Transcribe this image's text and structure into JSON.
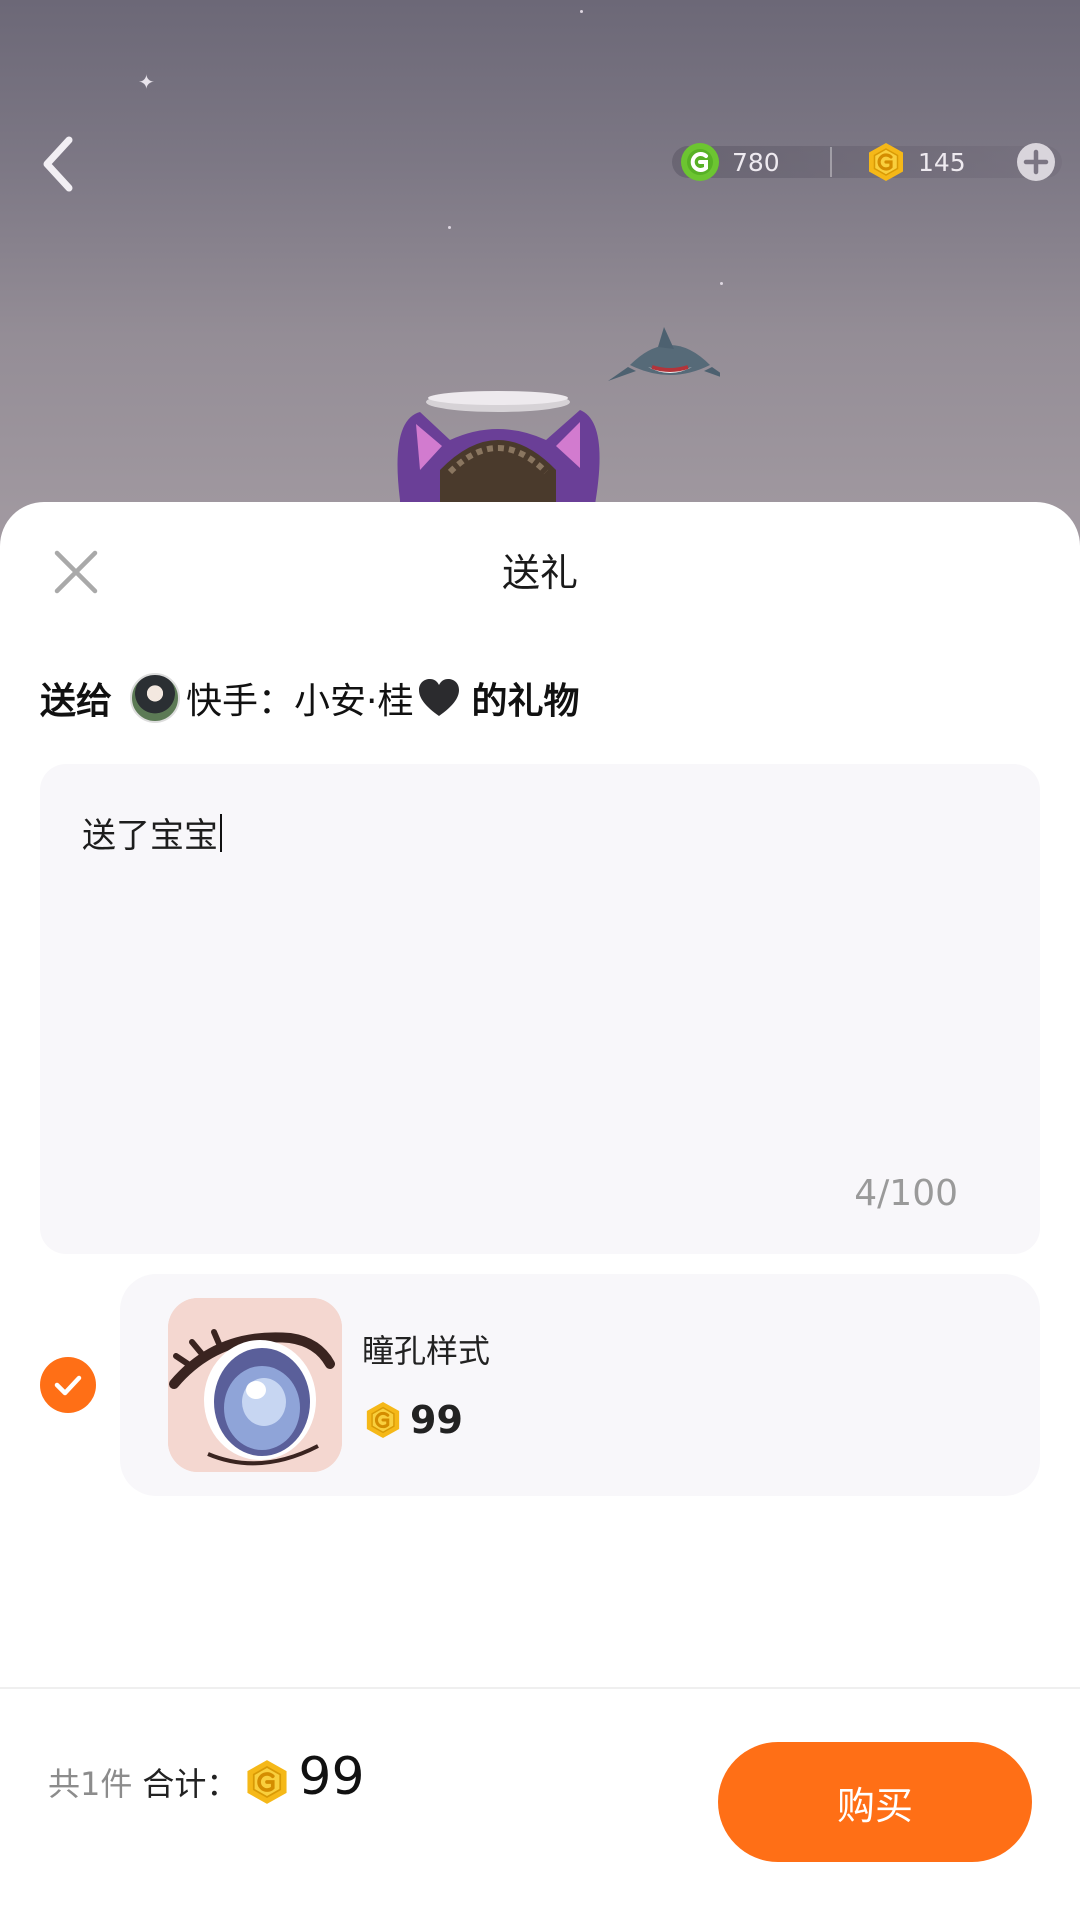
{
  "header": {
    "back_icon": "chevron-left-icon",
    "green_coin_balance": "780",
    "gold_coin_balance": "145",
    "add_icon": "plus-circle-icon"
  },
  "sheet": {
    "title": "送礼",
    "close_icon": "close-icon",
    "recipient": {
      "prefix": "送给",
      "name": "快手：小安·桂",
      "suffix": "的礼物",
      "heart_color": "#2b2b2e"
    },
    "message": {
      "value": "送了宝宝",
      "count": "4/100"
    },
    "gift": {
      "selected": true,
      "name": "瞳孔样式",
      "price": "99"
    },
    "footer": {
      "quantity": "共1件",
      "total_label": "合计：",
      "total": "99",
      "buy_label": "购买"
    }
  },
  "colors": {
    "accent": "#ff6f16",
    "coin_gold": "#f5b818",
    "coin_green": "#6cc531"
  }
}
